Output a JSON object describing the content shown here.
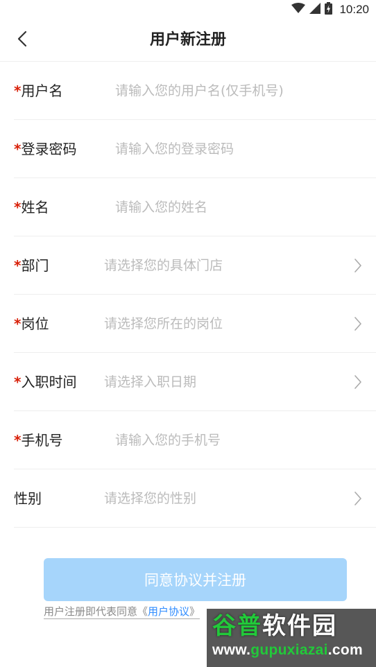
{
  "status_bar": {
    "time": "10:20",
    "icons": [
      "wifi-icon",
      "signal-icon",
      "battery-charging-icon"
    ]
  },
  "nav": {
    "back_icon": "chevron-left-icon",
    "title": "用户新注册"
  },
  "form": {
    "required_mark": "*",
    "fields": [
      {
        "label": "用户名",
        "placeholder": "请输入您的用户名(仅手机号)"
      },
      {
        "label": "登录密码",
        "placeholder": "请输入您的登录密码"
      },
      {
        "label": "姓名",
        "placeholder": "请输入您的姓名"
      },
      {
        "label": "部门",
        "placeholder": "请选择您的具体门店"
      },
      {
        "label": "岗位",
        "placeholder": "请选择您所在的岗位"
      },
      {
        "label": "入职时间",
        "placeholder": "请选择入职日期"
      },
      {
        "label": "手机号",
        "placeholder": "请输入您的手机号"
      },
      {
        "label": "性别",
        "placeholder": "请选择您的性别"
      }
    ]
  },
  "submit": {
    "label": "同意协议并注册"
  },
  "agreement": {
    "prefix": "用户注册即代表同意《",
    "link": "用户协议",
    "suffix": "》"
  },
  "watermark": {
    "logo_green": "谷普",
    "logo_white": "软件园",
    "url_white_1": "www.",
    "url_green": "gupuxiazai",
    "url_white_2": ".com"
  },
  "colors": {
    "required": "#d81e06",
    "button": "#a6d5fb",
    "link": "#2f8cff",
    "placeholder": "#bbbbbb"
  }
}
